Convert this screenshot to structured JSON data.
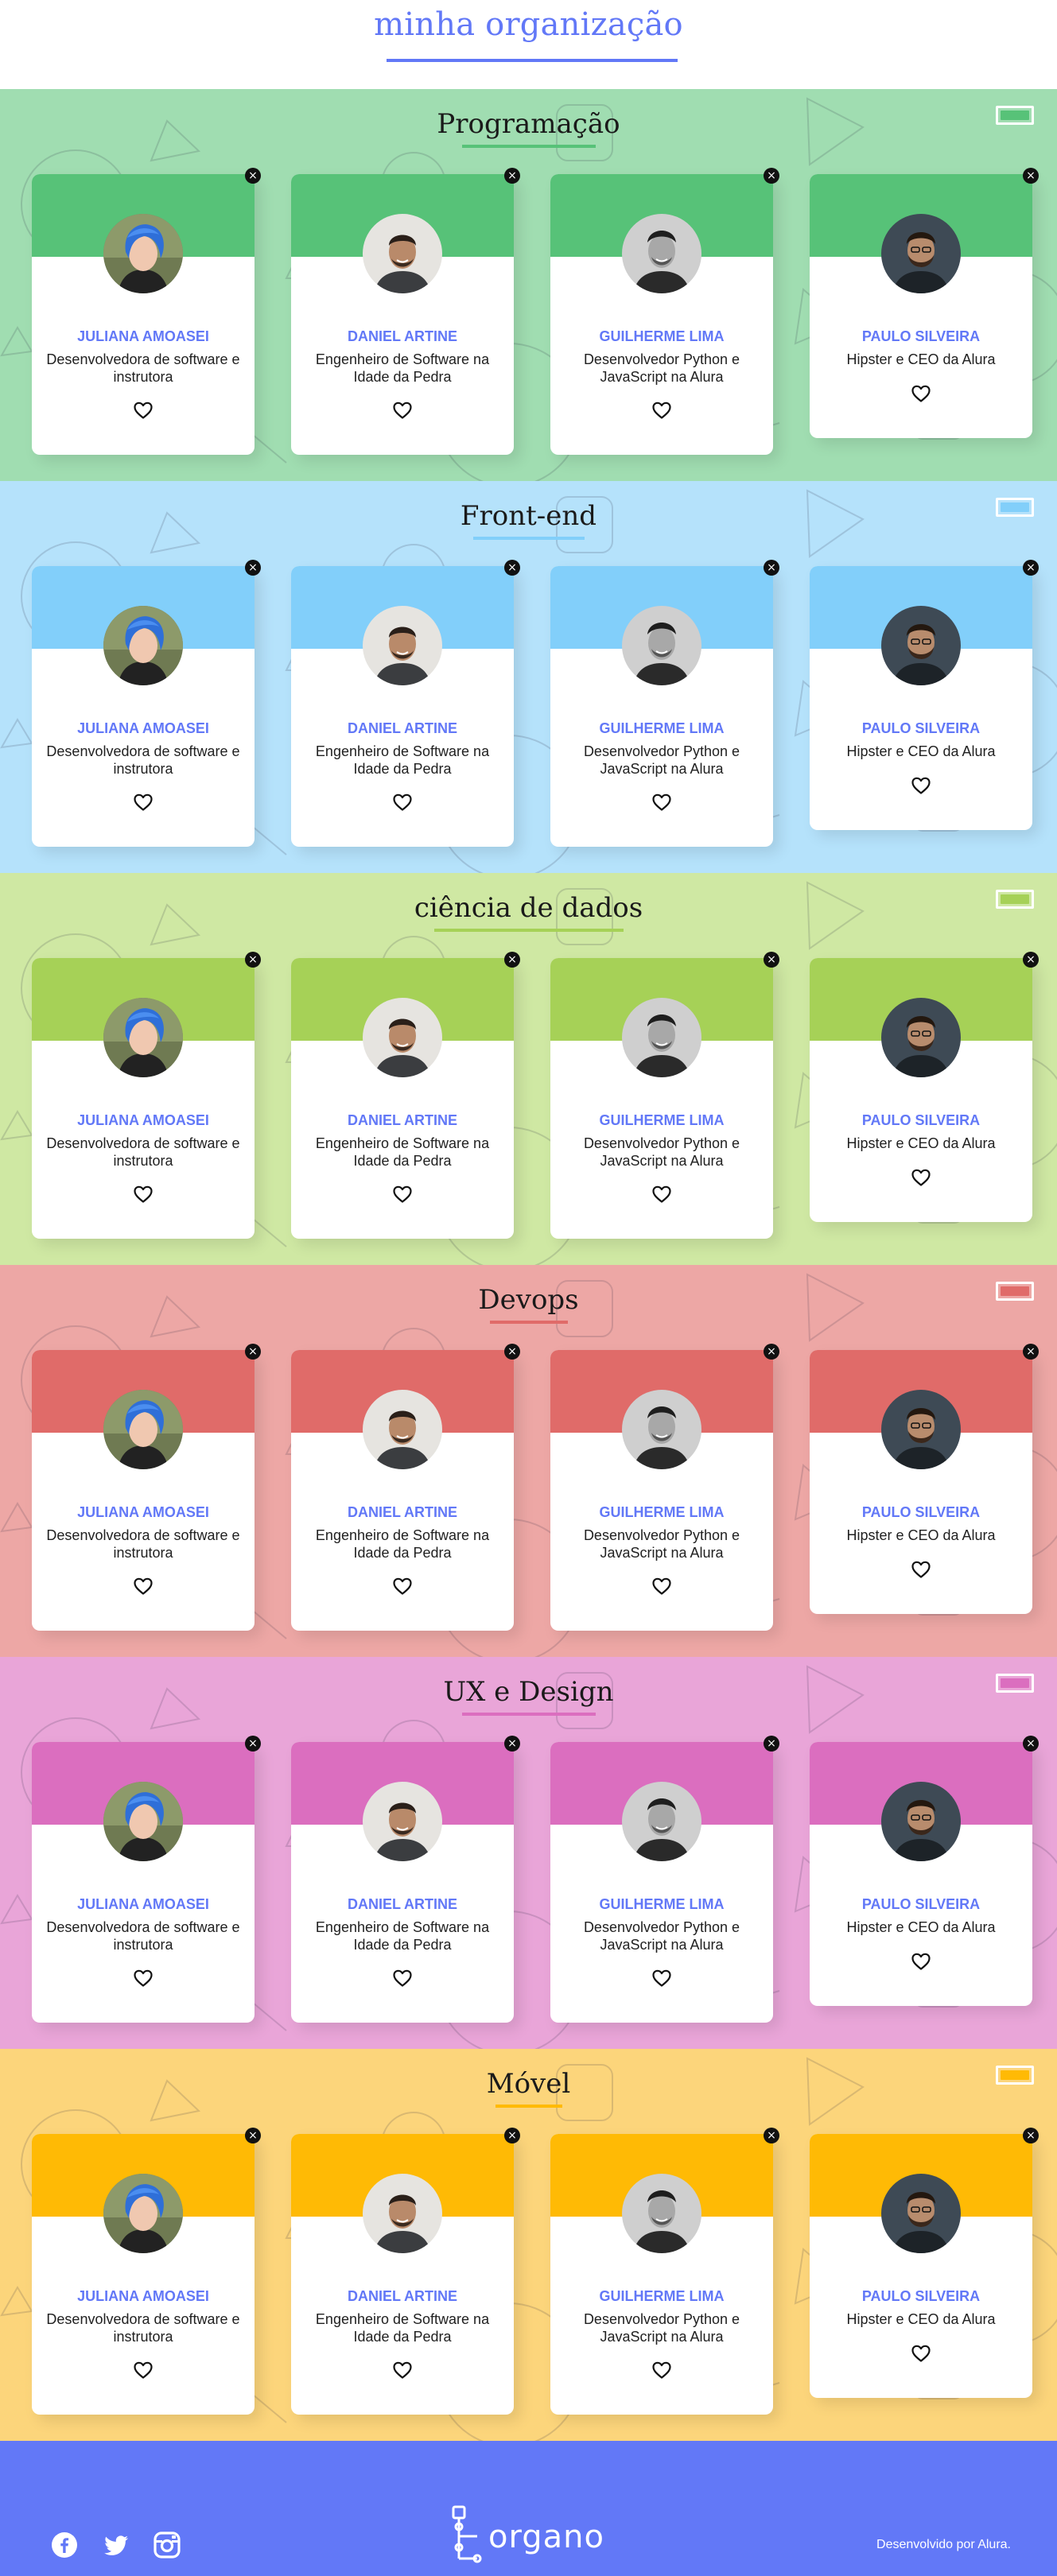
{
  "header": {
    "title": "minha organização"
  },
  "members": [
    {
      "name": "JULIANA AMOASEI",
      "role": "Desenvolvedora de software e instrutora",
      "avatar": "juliana"
    },
    {
      "name": "DANIEL ARTINE",
      "role": "Engenheiro de Software na Idade da Pedra",
      "avatar": "daniel"
    },
    {
      "name": "GUILHERME LIMA",
      "role": "Desenvolvedor Python e JavaScript na Alura",
      "avatar": "guilherme"
    },
    {
      "name": "PAULO SILVEIRA",
      "role": "Hipster e CEO da Alura",
      "avatar": "paulo"
    }
  ],
  "teams": [
    {
      "name": "Programação",
      "primary_color": "#57C278",
      "secondary_color": "#A0DDB1"
    },
    {
      "name": "Front-end",
      "primary_color": "#82CFFA",
      "secondary_color": "#B5E2FB"
    },
    {
      "name": "ciência de dados",
      "primary_color": "#A6D157",
      "secondary_color": "#CFE8A3"
    },
    {
      "name": "Devops",
      "primary_color": "#E06B69",
      "secondary_color": "#EDA7A5"
    },
    {
      "name": "UX e Design",
      "primary_color": "#DB6EBF",
      "secondary_color": "#E9A5D8"
    },
    {
      "name": "Móvel",
      "primary_color": "#FFBA05",
      "secondary_color": "#FCD57B"
    }
  ],
  "icons": {
    "delete": "close-icon",
    "favorite": "heart-icon",
    "color_picker": "color-picker-icon"
  },
  "footer": {
    "logo_text": "organo",
    "credit": "Desenvolvido por Alura.",
    "social_icons": [
      "facebook-icon",
      "twitter-icon",
      "instagram-icon"
    ]
  },
  "colors": {
    "accent": "#6278F7",
    "footer_bg": "#6278F7"
  }
}
